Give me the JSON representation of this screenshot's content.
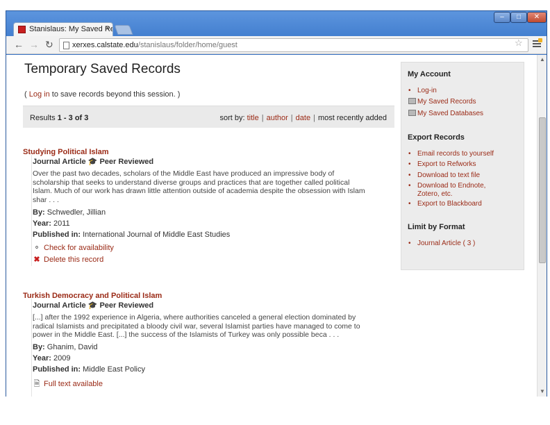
{
  "browser": {
    "tab_title": "Stanislaus: My Saved Reco",
    "tab_close": "×",
    "url_host": "xerxes.calstate.edu",
    "url_path": "/stanislaus/folder/home/guest"
  },
  "page": {
    "title": "Temporary Saved Records",
    "login_prefix": "(",
    "login_link": "Log in",
    "login_suffix": "to save records beyond this session. )",
    "results_label": "Results",
    "results_range": "1 - 3 of 3",
    "sort_label": "sort by:",
    "sort_title": "title",
    "sort_author": "author",
    "sort_date": "date",
    "sort_recent": "most recently added"
  },
  "records": [
    {
      "title": "Studying Political Islam",
      "type": "Journal Article",
      "peer": "Peer Reviewed",
      "abstract": [
        "Over the past two decades, scholars of the Middle East have produced an impressive body of",
        "scholarship that seeks to understand diverse groups and practices that are together called political",
        "Islam. Much of our work has drawn little attention outside of academia despite the obsession with Islam",
        "shar . . ."
      ],
      "by_label": "By:",
      "by": "Schwedler, Jillian",
      "year_label": "Year:",
      "year": "2011",
      "pub_label": "Published in:",
      "pub": "International Journal of Middle East Studies",
      "action1": "Check for availability",
      "action2": "Delete this record"
    },
    {
      "title": "Turkish Democracy and Political Islam",
      "type": "Journal Article",
      "peer": "Peer Reviewed",
      "abstract": [
        "[...] after the 1992 experience in Algeria, where authorities canceled a general election dominated by",
        "radical Islamists and precipitated a bloody civil war, several Islamist parties have managed to come to",
        "power in the Middle East. [...] the success of the Islamists of Turkey was only possible beca . . ."
      ],
      "by_label": "By:",
      "by": "Ghanim, David",
      "year_label": "Year:",
      "year": "2009",
      "pub_label": "Published in:",
      "pub": "Middle East Policy",
      "action1": "Full text available"
    }
  ],
  "sidebar": {
    "account_heading": "My Account",
    "account_items": [
      "Log-in",
      "My Saved Records",
      "My Saved Databases"
    ],
    "export_heading": "Export Records",
    "export_items": [
      "Email records to yourself",
      "Export to Refworks",
      "Download to text file",
      "Download to Endnote,",
      "Zotero, etc.",
      "Export to Blackboard"
    ],
    "limit_heading": "Limit by Format",
    "limit_items": [
      "Journal Article ( 3 )"
    ]
  },
  "colors": {
    "link": "#9a2a16",
    "title_bar": "#3f7ccd"
  }
}
